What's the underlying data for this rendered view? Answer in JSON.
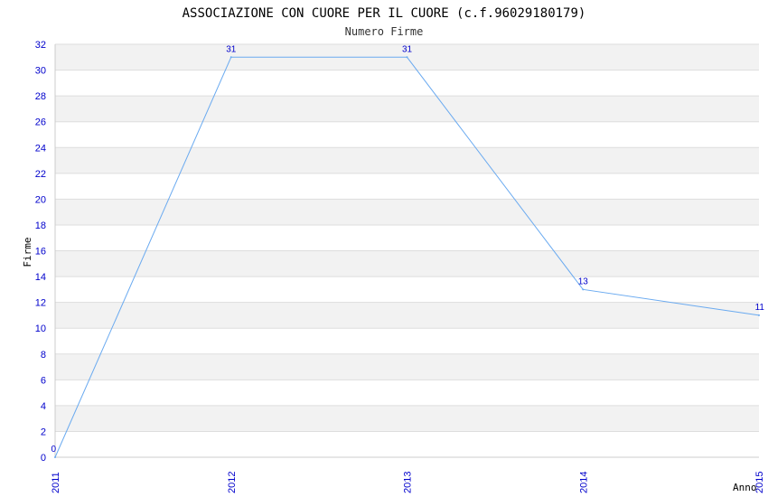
{
  "chart_data": {
    "type": "line",
    "title": "ASSOCIAZIONE CON CUORE PER IL CUORE (c.f.96029180179)",
    "subtitle": "Numero Firme",
    "xlabel": "Anno",
    "ylabel": "Firme",
    "categories": [
      "2011",
      "2012",
      "2013",
      "2014",
      "2015"
    ],
    "series": [
      {
        "values": [
          0,
          31,
          31,
          13,
          11
        ]
      }
    ],
    "data_labels": [
      "0",
      "31",
      "31",
      "13",
      "11"
    ],
    "ylim": [
      0,
      32
    ],
    "yticks": [
      "0",
      "2",
      "4",
      "6",
      "8",
      "10",
      "12",
      "14",
      "16",
      "18",
      "20",
      "22",
      "24",
      "26",
      "28",
      "30",
      "32"
    ],
    "grid": true,
    "colors": {
      "line": "#6aaaf0",
      "tick_text": "#0000cc",
      "band": "#f2f2f2",
      "grid": "#dddddd",
      "axis": "#cccccc"
    }
  }
}
